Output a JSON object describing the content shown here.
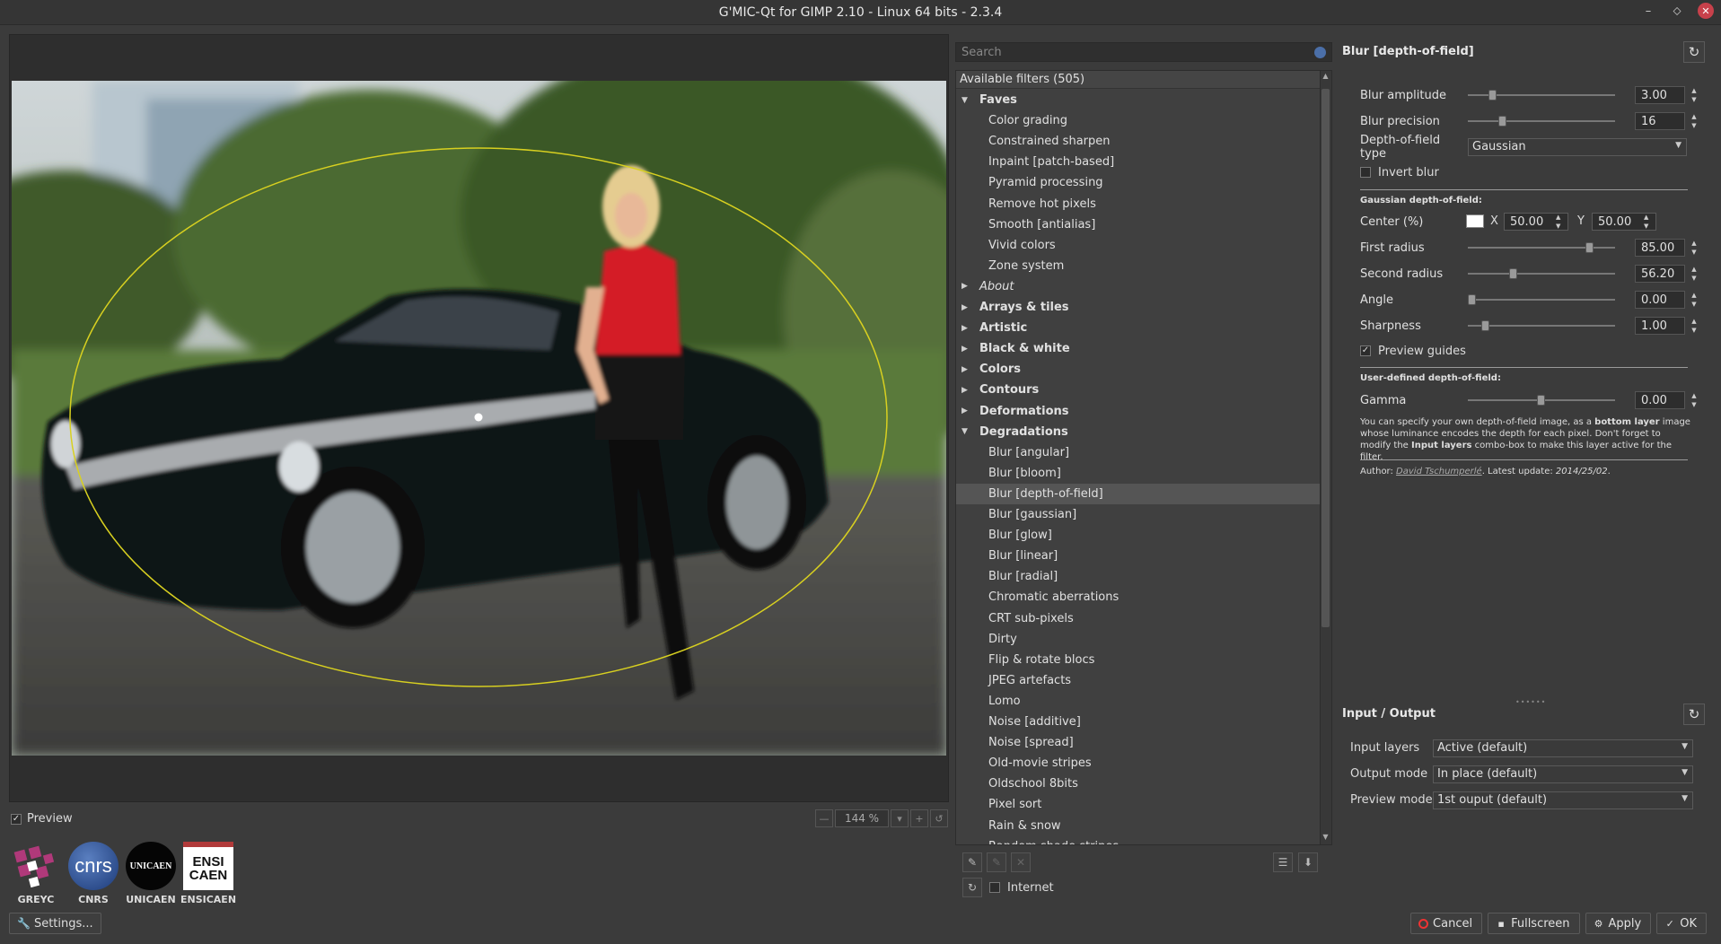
{
  "window": {
    "title": "G'MIC-Qt for GIMP 2.10 - Linux 64 bits - 2.3.4"
  },
  "preview": {
    "checkbox_label": "Preview",
    "zoom": "144 %"
  },
  "logos": [
    {
      "caption": "GREYC"
    },
    {
      "caption": "CNRS",
      "text": "cnrs"
    },
    {
      "caption": "UNICAEN",
      "text": "UNICAEN"
    },
    {
      "caption": "ENSICAEN",
      "text": "ENSI\nCAEN"
    }
  ],
  "settings_button": "Settings...",
  "search": {
    "placeholder": "Search"
  },
  "tree": {
    "header": "Available filters (505)",
    "rows": [
      {
        "label": "Faves",
        "type": "cat",
        "expanded": true
      },
      {
        "label": "Color grading",
        "type": "leaf"
      },
      {
        "label": "Constrained sharpen",
        "type": "leaf"
      },
      {
        "label": "Inpaint [patch-based]",
        "type": "leaf"
      },
      {
        "label": "Pyramid processing",
        "type": "leaf"
      },
      {
        "label": "Remove hot pixels",
        "type": "leaf"
      },
      {
        "label": "Smooth [antialias]",
        "type": "leaf"
      },
      {
        "label": "Vivid colors",
        "type": "leaf"
      },
      {
        "label": "Zone system",
        "type": "leaf"
      },
      {
        "label": "About",
        "type": "italic"
      },
      {
        "label": "Arrays & tiles",
        "type": "cat"
      },
      {
        "label": "Artistic",
        "type": "cat"
      },
      {
        "label": "Black & white",
        "type": "cat"
      },
      {
        "label": "Colors",
        "type": "cat"
      },
      {
        "label": "Contours",
        "type": "cat"
      },
      {
        "label": "Deformations",
        "type": "cat"
      },
      {
        "label": "Degradations",
        "type": "cat",
        "expanded": true
      },
      {
        "label": "Blur [angular]",
        "type": "leaf"
      },
      {
        "label": "Blur [bloom]",
        "type": "leaf"
      },
      {
        "label": "Blur [depth-of-field]",
        "type": "leaf",
        "selected": true
      },
      {
        "label": "Blur [gaussian]",
        "type": "leaf"
      },
      {
        "label": "Blur [glow]",
        "type": "leaf"
      },
      {
        "label": "Blur [linear]",
        "type": "leaf"
      },
      {
        "label": "Blur [radial]",
        "type": "leaf"
      },
      {
        "label": "Chromatic aberrations",
        "type": "leaf"
      },
      {
        "label": "CRT sub-pixels",
        "type": "leaf"
      },
      {
        "label": "Dirty",
        "type": "leaf"
      },
      {
        "label": "Flip & rotate blocs",
        "type": "leaf"
      },
      {
        "label": "JPEG artefacts",
        "type": "leaf"
      },
      {
        "label": "Lomo",
        "type": "leaf"
      },
      {
        "label": "Noise [additive]",
        "type": "leaf"
      },
      {
        "label": "Noise [spread]",
        "type": "leaf"
      },
      {
        "label": "Old-movie stripes",
        "type": "leaf"
      },
      {
        "label": "Oldschool 8bits",
        "type": "leaf"
      },
      {
        "label": "Pixel sort",
        "type": "leaf"
      },
      {
        "label": "Rain & snow",
        "type": "leaf"
      },
      {
        "label": "Random shade stripes",
        "type": "leaf"
      }
    ]
  },
  "internet_label": "Internet",
  "filter": {
    "title": "Blur [depth-of-field]",
    "blur_amplitude": {
      "label": "Blur amplitude",
      "value": "3.00",
      "fraction": 0.15
    },
    "blur_precision": {
      "label": "Blur precision",
      "value": "16",
      "fraction": 0.22
    },
    "dof_type": {
      "label": "Depth-of-field type",
      "value": "Gaussian"
    },
    "invert_blur": {
      "label": "Invert blur",
      "checked": false
    },
    "gaussian_section": "Gaussian depth-of-field:",
    "center": {
      "label": "Center (%)",
      "x_label": "X",
      "x": "50.00",
      "y_label": "Y",
      "y": "50.00"
    },
    "first_radius": {
      "label": "First radius",
      "value": "85.00",
      "fraction": 0.85
    },
    "second_radius": {
      "label": "Second radius",
      "value": "56.20",
      "fraction": 0.3
    },
    "angle": {
      "label": "Angle",
      "value": "0.00",
      "fraction": 0.0
    },
    "sharpness": {
      "label": "Sharpness",
      "value": "1.00",
      "fraction": 0.1
    },
    "preview_guides": {
      "label": "Preview guides",
      "checked": true
    },
    "user_section": "User-defined depth-of-field:",
    "gamma": {
      "label": "Gamma",
      "value": "0.00",
      "fraction": 0.5
    },
    "note_1": "You can specify your own depth-of-field image, as a ",
    "note_bold_1": "bottom layer",
    "note_2": " image whose luminance encodes the depth for each pixel. Don't forget to modify the ",
    "note_bold_2": "Input layers",
    "note_3": " combo-box to make this layer active for the filter.",
    "author_prefix": "Author: ",
    "author": "David Tschumperlé",
    "update_prefix": ". Latest update: ",
    "update": "2014/25/02",
    "update_suffix": "."
  },
  "io": {
    "title": "Input / Output",
    "input_layers": {
      "label": "Input layers",
      "value": "Active (default)"
    },
    "output_mode": {
      "label": "Output mode",
      "value": "In place (default)"
    },
    "preview_mode": {
      "label": "Preview mode",
      "value": "1st ouput (default)"
    }
  },
  "buttons": {
    "cancel": "Cancel",
    "fullscreen": "Fullscreen",
    "apply": "Apply",
    "ok": "OK"
  }
}
